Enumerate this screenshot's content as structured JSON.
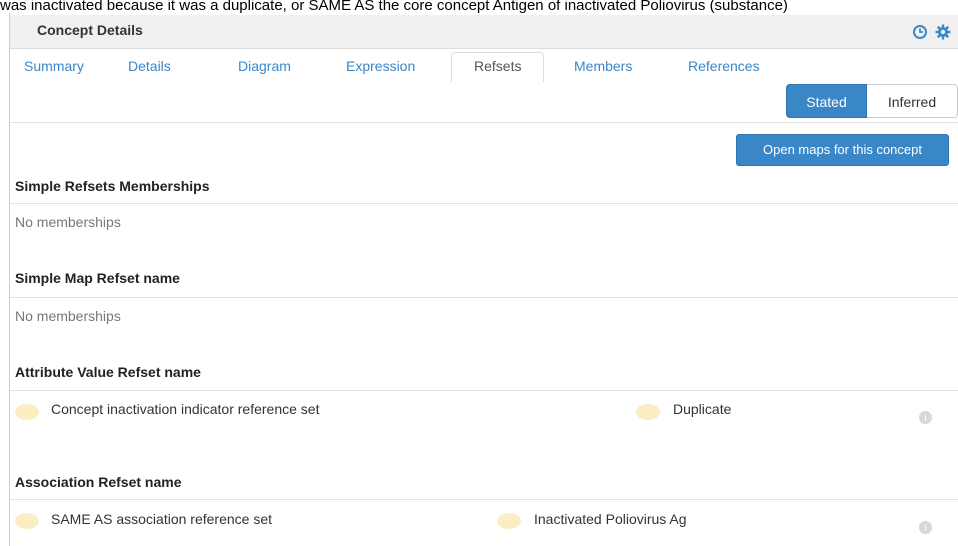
{
  "caption": "was inactivated because it was a duplicate, or SAME AS the core concept Antigen of inactivated Poliovirus (substance)",
  "panel": {
    "title": "Concept Details",
    "header_icons": [
      "history-clock-icon",
      "gear-icon"
    ]
  },
  "tabs": [
    {
      "label": "Summary",
      "active": false
    },
    {
      "label": "Details",
      "active": false
    },
    {
      "label": "Diagram",
      "active": false
    },
    {
      "label": "Expression",
      "active": false
    },
    {
      "label": "Refsets",
      "active": true
    },
    {
      "label": "Members",
      "active": false
    },
    {
      "label": "References",
      "active": false
    }
  ],
  "view_toggle": {
    "stated": "Stated",
    "inferred": "Inferred",
    "selected": "Stated"
  },
  "open_maps_button": "Open maps for this concept",
  "sections": {
    "simple_refsets": {
      "title": "Simple Refsets Memberships",
      "empty": "No memberships"
    },
    "simple_map": {
      "title": "Simple Map Refset name",
      "empty": "No memberships"
    },
    "attribute_value": {
      "title": "Attribute Value Refset name",
      "rows": [
        {
          "refset": "Concept inactivation indicator reference set",
          "value": "Duplicate"
        }
      ]
    },
    "association": {
      "title": "Association Refset name",
      "rows": [
        {
          "refset": "SAME AS association reference set",
          "value": "Inactivated Poliovirus Ag"
        }
      ]
    }
  },
  "colors": {
    "accent": "#3a87c8",
    "status_dot": "#fbeec4"
  }
}
